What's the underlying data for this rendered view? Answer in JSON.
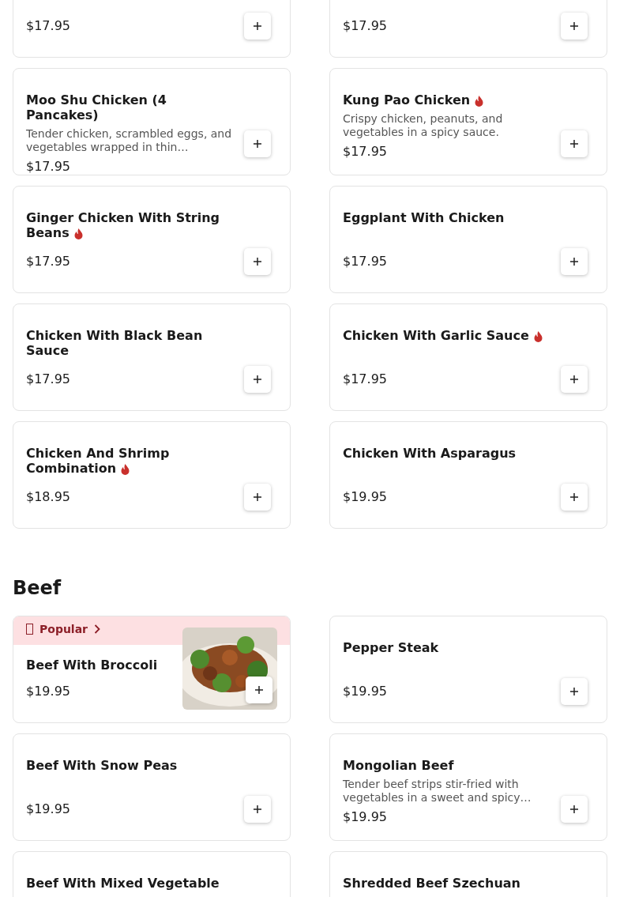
{
  "sections": [
    {
      "items": [
        {
          "price": "$17.95"
        },
        {
          "price": "$17.95"
        },
        {
          "name": "Moo Shu Chicken (4 Pancakes)",
          "description": "Tender chicken, scrambled eggs, and vegetables wrapped in thin…",
          "price": "$17.95",
          "spicy": false
        },
        {
          "name": "Kung Pao Chicken",
          "description": "Crispy chicken, peanuts, and vegetables in a spicy sauce.",
          "price": "$17.95",
          "spicy": true
        },
        {
          "name": "Ginger Chicken With String Beans",
          "price": "$17.95",
          "spicy": true
        },
        {
          "name": "Eggplant With Chicken",
          "price": "$17.95",
          "spicy": false
        },
        {
          "name": "Chicken With Black Bean Sauce",
          "price": "$17.95",
          "spicy": false
        },
        {
          "name": "Chicken With Garlic Sauce",
          "price": "$17.95",
          "spicy": true
        },
        {
          "name": "Chicken And Shrimp Combination",
          "price": "$18.95",
          "spicy": true
        },
        {
          "name": "Chicken With Asparagus",
          "price": "$19.95",
          "spicy": false
        }
      ]
    },
    {
      "title": "Beef",
      "items": [
        {
          "badge": "Popular",
          "name": "Beef With Broccoli",
          "price": "$19.95",
          "spicy": false
        },
        {
          "name": "Pepper Steak",
          "price": "$19.95",
          "spicy": false
        },
        {
          "name": "Beef With Snow Peas",
          "price": "$19.95",
          "spicy": false
        },
        {
          "name": "Mongolian Beef",
          "description": "Tender beef strips stir-fried with vegetables in a sweet and spicy…",
          "price": "$19.95",
          "spicy": false
        },
        {
          "name": "Beef With Mixed Vegetable",
          "spicy": false
        },
        {
          "name": "Shredded Beef Szechuan",
          "spicy": false
        }
      ]
    }
  ]
}
